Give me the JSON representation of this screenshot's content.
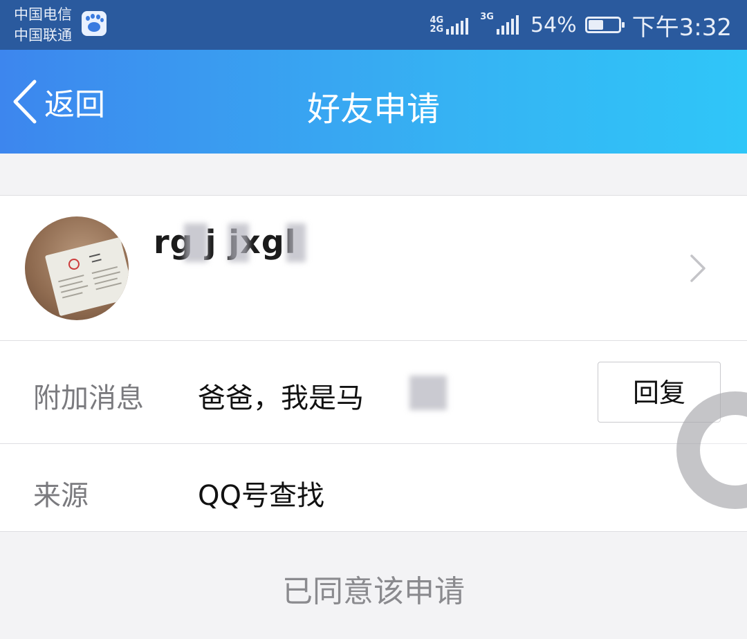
{
  "status_bar": {
    "carrier_1": "中国电信",
    "carrier_2": "中国联通",
    "net_1_top": "4G",
    "net_1_bottom": "2G",
    "net_2": "3G",
    "battery": "54%",
    "battery_level": 0.54,
    "time": "下午3:32",
    "app_icon": "baidu-icon"
  },
  "header": {
    "back_label": "返回",
    "title": "好友申请"
  },
  "profile": {
    "username": "rg  j  jxgl"
  },
  "message_row": {
    "label": "附加消息",
    "value": "爸爸，我是马",
    "reply_button": "回复"
  },
  "source_row": {
    "label": "来源",
    "value": "QQ号查找"
  },
  "status": {
    "text": "已同意该申请"
  },
  "colors": {
    "status_bar": "#2a5a9e",
    "header_start": "#3d86ee",
    "header_end": "#2fc6f8",
    "background": "#f3f3f5"
  }
}
